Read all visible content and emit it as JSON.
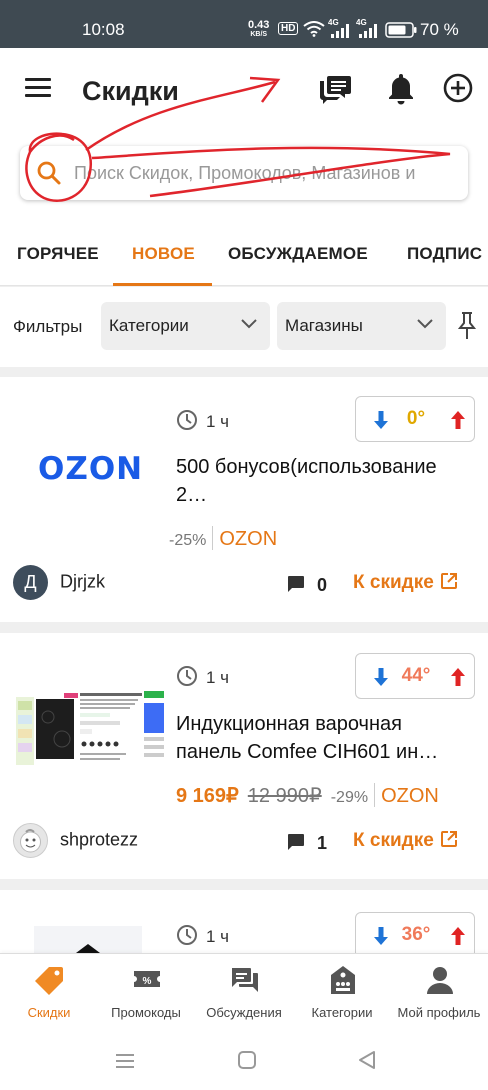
{
  "status_bar": {
    "time": "10:08",
    "net_speed": "0.43",
    "net_unit": "KB/S",
    "hd": "HD",
    "sig1": "4G",
    "sig2": "4G",
    "battery": "70 %"
  },
  "app_bar": {
    "title": "Скидки"
  },
  "search": {
    "placeholder": "Поиск Скидок, Промокодов, Магазинов и"
  },
  "tabs": [
    {
      "label": "ГОРЯЧЕЕ",
      "active": false
    },
    {
      "label": "НОВОЕ",
      "active": true
    },
    {
      "label": "ОБСУЖДАЕМОЕ",
      "active": false
    },
    {
      "label": "ПОДПИС",
      "active": false
    }
  ],
  "filters": {
    "label": "Фильтры",
    "categories": "Категории",
    "shops": "Магазины"
  },
  "deals": [
    {
      "time": "1 ч",
      "temperature": "0°",
      "temperature_color": "#e0a800",
      "thumb_text": "OZON",
      "title": "500 бонусов(использование 2…",
      "discount": "-25%",
      "store": "OZON",
      "user": "Djrjzk",
      "user_initial": "Д",
      "comments": "0",
      "link": "К скидке"
    },
    {
      "time": "1 ч",
      "temperature": "44°",
      "temperature_color": "#f07a5a",
      "title": "Индукционная варочная панель Comfee CIH601 ин…",
      "price": "9 169₽",
      "old_price": "12 990₽",
      "discount": "-29%",
      "store": "OZON",
      "user": "shprotezz",
      "comments": "1",
      "link": "К скидке"
    },
    {
      "time": "1 ч",
      "temperature": "36°",
      "temperature_color": "#f07a5a"
    }
  ],
  "bottom_nav": [
    {
      "label": "Скидки",
      "icon": "tag-icon",
      "active": true
    },
    {
      "label": "Промокоды",
      "icon": "coupon-icon",
      "active": false
    },
    {
      "label": "Обсуждения",
      "icon": "chat-icon",
      "active": false
    },
    {
      "label": "Категории",
      "icon": "categories-icon",
      "active": false
    },
    {
      "label": "Мой профиль",
      "icon": "person-icon",
      "active": false
    }
  ],
  "colors": {
    "accent": "#e57716",
    "vote_down": "#1e73d6",
    "vote_up": "#e02424",
    "status_bar": "#3f4a52",
    "annotation": "#e0252c"
  }
}
